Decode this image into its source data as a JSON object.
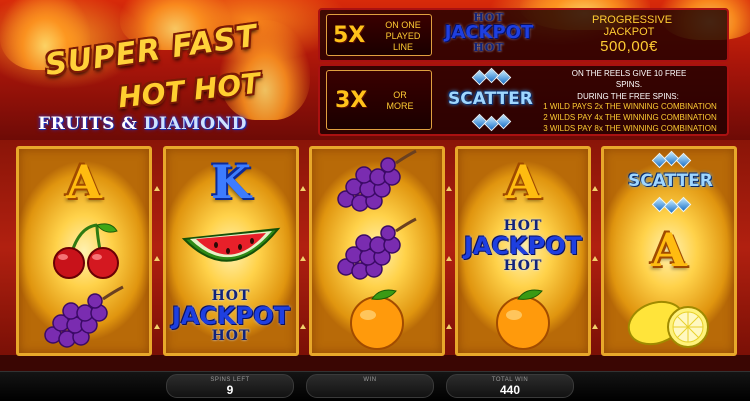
{
  "logo": {
    "line1": "SUPER FAST",
    "line2": "HOT HOT",
    "sub_fruits": "FRUITS &",
    "sub_diamond": "DIAMOND"
  },
  "jackpot_panel": {
    "multiplier": "5X",
    "condition": "ON ONE PLAYED LINE",
    "symbol_hot_top": "HOT",
    "symbol_main": "JACKPOT",
    "symbol_hot_bottom": "HOT",
    "progressive_title": "PROGRESSIVE JACKPOT",
    "progressive_value": "500,00€"
  },
  "scatter_panel": {
    "multiplier": "3X",
    "condition": "OR MORE",
    "symbol": "SCATTER",
    "reels_text": "ON THE REELS GIVE 10 FREE SPINS.",
    "during_text": "DURING THE FREE SPINS:",
    "wild_lines": [
      "1 WILD PAYS 2x THE WINNING COMBINATION",
      "2 WILDS PAY 4x THE WINNING COMBINATION",
      "3 WILDS PAY 8x THE WINNING COMBINATION"
    ]
  },
  "reels": [
    [
      "A",
      "cherry",
      "grapes"
    ],
    [
      "K",
      "watermelon",
      "jackpot"
    ],
    [
      "grapes",
      "grapes",
      "orange"
    ],
    [
      "A",
      "jackpot",
      "orange"
    ],
    [
      "scatter",
      "A",
      "lemon"
    ]
  ],
  "symbol_text": {
    "ace": "A",
    "king": "K",
    "jackpot_hot": "HOT",
    "jackpot_main": "JACKPOT",
    "scatter": "SCATTER"
  },
  "status": {
    "spins_left_label": "SPINS LEFT",
    "spins_left_value": "9",
    "win_label": "WIN",
    "win_value": "",
    "total_win_label": "TOTAL WIN",
    "total_win_value": "440"
  },
  "colors": {
    "reel_gold": "#ffd24a",
    "panel_border": "#aa1111",
    "gold_text": "#ffcc33"
  }
}
